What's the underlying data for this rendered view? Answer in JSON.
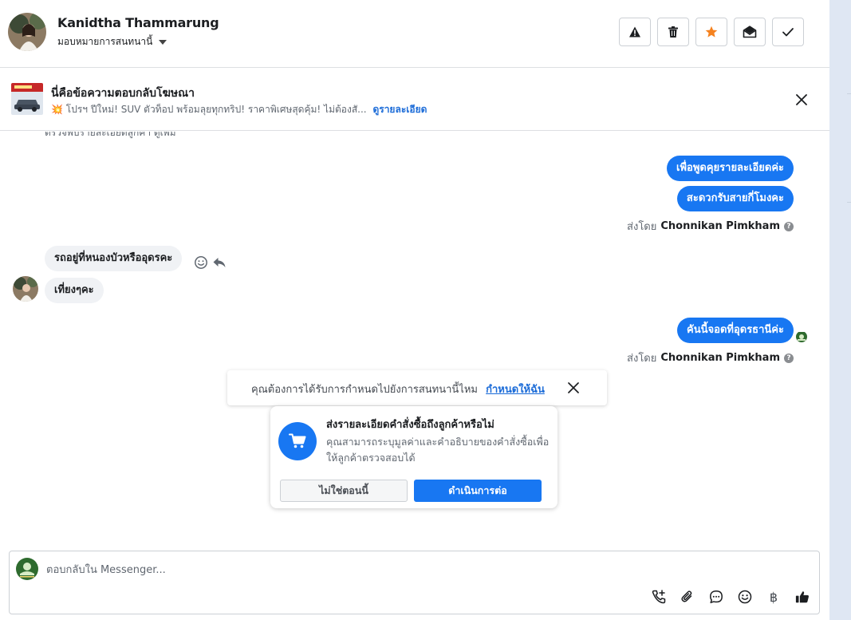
{
  "header": {
    "contact_name": "Kanidtha Thammarung",
    "assign_label": "มอบหมายการสนทนานี้",
    "actions": [
      {
        "icon": "spam-warning-icon",
        "name": "mark-spam-button"
      },
      {
        "icon": "trash-icon",
        "name": "delete-button"
      },
      {
        "icon": "star-icon",
        "name": "star-button"
      },
      {
        "icon": "mark-unread-icon",
        "name": "mark-unread-button"
      },
      {
        "icon": "checkmark-icon",
        "name": "mark-done-button"
      }
    ]
  },
  "ad_banner": {
    "title": "นี่คือข้อความตอบกลับโฆษณา",
    "description": "💥 โปรฯ ปีใหม่! SUV ตัวท็อป พร้อมลุยทุกทริป! ราคาพิเศษสุดคุ้ม! ไม่ต้องสั...",
    "more_link": "ดูรายละเอียด"
  },
  "conversation": {
    "cut_off_text": "ตรวจพบรายละเอียดลูกค้า ดูเพิ่ม",
    "outgoing_group_1": [
      "เพื่อพูดคุยรายละเอียดค่ะ",
      "สะดวกรับสายกี่โมงคะ"
    ],
    "sent_by_prefix": "ส่งโดย",
    "agent_name": "Chonnikan Pimkham",
    "help_mark": "?",
    "incoming": [
      "รถอยู่ที่หนองบัวหรืออุดรคะ",
      "เที่ยงๆคะ"
    ],
    "outgoing_group_2": [
      "คันนี้จอดที่อุดรธานีค่ะ"
    ]
  },
  "followup_toast": {
    "text": "คุณต้องการได้รับการกำหนดไปยังการสนทนานี้ไหม",
    "link": "กำหนดให้ฉัน"
  },
  "order_card": {
    "title": "ส่งรายละเอียดคำสั่งซื้อถึงลูกค้าหรือไม่",
    "description": "คุณสามารถระบุมูลค่าและคำอธิบายของคำสั่งซื้อเพื่อให้ลูกค้าตรวจสอบได้",
    "decline_label": "ไม่ใช่ตอนนี้",
    "confirm_label": "ดำเนินการต่อ"
  },
  "composer": {
    "placeholder": "ตอบกลับใน Messenger...",
    "value": "",
    "currency_symbol": "฿",
    "tools": [
      "call-add-icon",
      "attachment-icon",
      "saved-reply-icon",
      "emoji-icon",
      "currency-baht-icon",
      "thumbs-up-icon"
    ]
  },
  "colors": {
    "brand_blue": "#1877f2",
    "star_orange": "#f5821f",
    "bubble_gray": "#f0f2f5",
    "link_blue": "#1c6cd8"
  }
}
